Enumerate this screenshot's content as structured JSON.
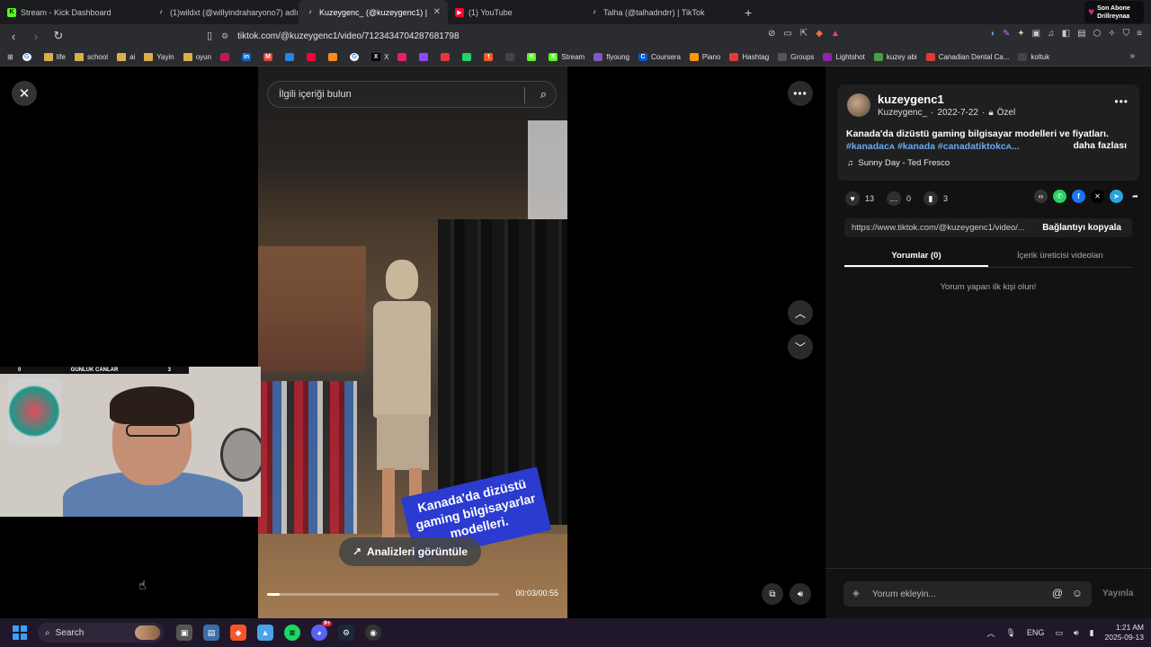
{
  "tabs": [
    {
      "title": "Stream - Kick Dashboard",
      "icon": "kick-icon",
      "color": "#53fc18"
    },
    {
      "title": "(1)wildxt (@willyindraharyono7) adlı",
      "icon": "tiktok-icon",
      "color": "#ffffff"
    },
    {
      "title": "Kuzeygenc_ (@kuzeygenc1) |",
      "icon": "tiktok-icon",
      "color": "#ffffff",
      "active": true
    },
    {
      "title": "(1) YouTube",
      "icon": "youtube-icon",
      "color": "#ff0033"
    },
    {
      "title": "Talha (@talhadndrr) | TikTok",
      "icon": "tiktok-icon",
      "color": "#ffffff"
    }
  ],
  "sub_badge": {
    "line1": "Son Abone",
    "line2": "Drillreynaa"
  },
  "address": {
    "url": "tiktok.com/@kuzeygenc1/video/7123434704287681798"
  },
  "bookmarks": [
    {
      "label": "",
      "color": "#ffffff",
      "kind": "google"
    },
    {
      "label": "life",
      "kind": "folder"
    },
    {
      "label": "school",
      "kind": "folder"
    },
    {
      "label": "ai",
      "kind": "folder"
    },
    {
      "label": "Yayin",
      "kind": "folder"
    },
    {
      "label": "oyun",
      "kind": "folder"
    },
    {
      "label": "",
      "color": "#c2185b"
    },
    {
      "label": "",
      "color": "#0a66c2",
      "text": "in"
    },
    {
      "label": "",
      "color": "#ea4335",
      "text": "M"
    },
    {
      "label": "",
      "color": "#1e88e5"
    },
    {
      "label": "",
      "color": "#ff0033"
    },
    {
      "label": "",
      "color": "#ff8c1a"
    },
    {
      "label": "",
      "color": "#ffffff",
      "kind": "google"
    },
    {
      "label": "X",
      "color": "#000000",
      "text": "X"
    },
    {
      "label": "",
      "color": "#e91e63"
    },
    {
      "label": "",
      "color": "#9146ff"
    },
    {
      "label": "",
      "color": "#e53935"
    },
    {
      "label": "",
      "color": "#25d366"
    },
    {
      "label": "",
      "color": "#ff5722",
      "text": "t"
    },
    {
      "label": "",
      "color": "#444444"
    },
    {
      "label": "",
      "color": "#53fc18",
      "text": "K"
    },
    {
      "label": "Stream",
      "color": "#53fc18",
      "text": "K"
    },
    {
      "label": "flyoung",
      "color": "#7e57c2"
    },
    {
      "label": "Coursera",
      "color": "#0056d2",
      "text": "C"
    },
    {
      "label": "Piano",
      "color": "#ff9800"
    },
    {
      "label": "Hashtag",
      "color": "#e53935"
    },
    {
      "label": "Groups",
      "color": "#555555"
    },
    {
      "label": "Lightshot",
      "color": "#8e24aa"
    },
    {
      "label": "kuzey abi",
      "color": "#43a047"
    },
    {
      "label": "Canadian Dental Ca...",
      "color": "#e53935"
    },
    {
      "label": "koltuk",
      "color": "#444444"
    }
  ],
  "video": {
    "search_placeholder": "İlgili içeriği bulun",
    "caption_line1": "Kanada'da dizüstü",
    "caption_line2": "gaming bilgisayarlar",
    "caption_line3": "modelleri.",
    "analytics_label": "Analizleri görüntüle",
    "time": "00:03/00:55",
    "progress": 0.055
  },
  "webcam": {
    "left_count": "0",
    "title": "GÜNLÜK CANLAR",
    "right_count": "3"
  },
  "panel": {
    "username": "kuzeygenc1",
    "handle": "Kuzeygenc_",
    "date": "2022-7-22",
    "privacy": "Özel",
    "description": "Kanada'da dizüstü gaming bilgisayar modelleri ve fiyatları.",
    "tags": "#kanadaᴄᴀ #kanada #canadatiktokᴄᴀ...",
    "more": "daha fazlası",
    "sound": "Sunny Day - Ted Fresco",
    "likes": "13",
    "comments": "0",
    "saves": "3",
    "link": "https://www.tiktok.com/@kuzeygenc1/video/...",
    "copy_label": "Bağlantıyı kopyala",
    "tab_comments": "Yorumlar (0)",
    "tab_videos": "İçerik üreticisi videoları",
    "empty": "Yorum yapan ilk kişi olun!",
    "comment_placeholder": "Yorum ekleyin...",
    "post_label": "Yayınla"
  },
  "taskbar": {
    "search": "Search",
    "lang": "ENG",
    "time": "1:21 AM",
    "date": "2025-09-13",
    "discord_badge": "9+"
  }
}
